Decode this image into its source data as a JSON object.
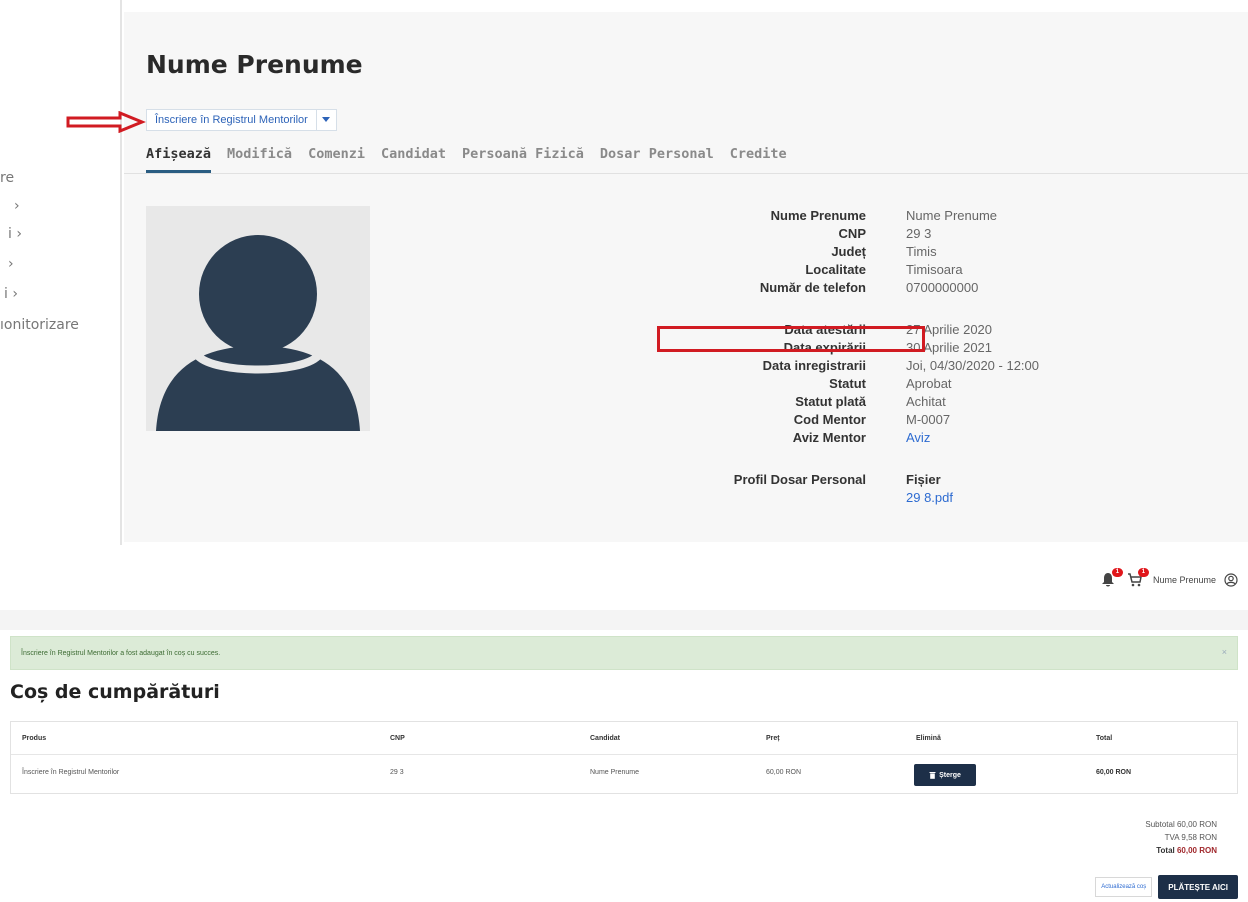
{
  "profile": {
    "nav_fragments": [
      "re",
      "›",
      "i ›",
      "›",
      "i ›",
      "ıonitorizare"
    ],
    "title": "Nume Prenume",
    "action_button": "Înscriere în Registrul Mentorilor",
    "tabs": [
      "Afișează",
      "Modifică",
      "Comenzi",
      "Candidat",
      "Persoană Fizică",
      "Dosar Personal",
      "Credite"
    ],
    "active_tab": "Afișează",
    "fields": [
      {
        "label": "Nume Prenume",
        "value": "Nume Prenume"
      },
      {
        "label": "CNP",
        "value": "29                    3"
      },
      {
        "label": "Județ",
        "value": "Timis"
      },
      {
        "label": "Localitate",
        "value": "Timisoara"
      },
      {
        "label": "Număr de telefon",
        "value": "0700000000"
      },
      {
        "label": "Data atestării",
        "value": "27 Aprilie 2020"
      },
      {
        "label": "Data expirării",
        "value": "30 Aprilie 2021"
      },
      {
        "label": "Data inregistrarii",
        "value": "Joi, 04/30/2020 - 12:00"
      },
      {
        "label": "Statut",
        "value": "Aprobat"
      },
      {
        "label": "Statut plată",
        "value": "Achitat"
      },
      {
        "label": "Cod Mentor",
        "value": "M-0007"
      },
      {
        "label": "Aviz Mentor",
        "value": "Aviz"
      },
      {
        "label": "Profil Dosar Personal",
        "value": "Fișier"
      }
    ],
    "file_link": "29                    8.pdf"
  },
  "cart": {
    "user_name": "Nume Prenume",
    "notification_count": "1",
    "cart_count": "1",
    "alert": "Înscriere în Registrul Mentorilor a fost adaugat în coș cu succes.",
    "alert_close": "×",
    "title": "Coș de cumpărături",
    "columns": [
      "Produs",
      "CNP",
      "Candidat",
      "Preț",
      "Elimină",
      "Total"
    ],
    "row": {
      "product": "Înscriere în Registrul Mentorilor",
      "cnp": "29                    3",
      "candidate": "Nume Prenume",
      "price": "60,00 RON",
      "delete": "Șterge",
      "total": "60,00 RON"
    },
    "subtotal": "Subtotal 60,00 RON",
    "vat": "TVA 9,58 RON",
    "total_label": "Total",
    "total_value": "60,00 RON",
    "update_button": "Actualizează coș",
    "pay_button": "PLĂTEȘTE AICI"
  },
  "colors": {
    "accent": "#2a5d82",
    "highlight": "#d11b22",
    "dark_button": "#1d2f48",
    "success": "#dcebd7"
  }
}
